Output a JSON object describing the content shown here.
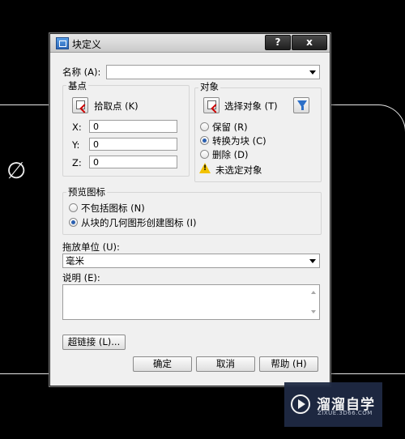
{
  "dialog": {
    "title": "块定义",
    "help_button": "?",
    "close_button": "x"
  },
  "name": {
    "label": "名称 (A):",
    "value": ""
  },
  "base_point": {
    "group_title": "基点",
    "pick_label": "拾取点 (K)",
    "x_label": "X:",
    "x_value": "0",
    "y_label": "Y:",
    "y_value": "0",
    "z_label": "Z:",
    "z_value": "0"
  },
  "objects": {
    "group_title": "对象",
    "select_label": "选择对象 (T)",
    "retain_label": "保留 (R)",
    "convert_label": "转换为块 (C)",
    "delete_label": "删除 (D)",
    "warning_text": "未选定对象",
    "selected_option": "convert"
  },
  "preview": {
    "group_title": "预览图标",
    "no_icon_label": "不包括图标 (N)",
    "create_icon_label": "从块的几何图形创建图标 (I)",
    "selected_option": "create"
  },
  "units": {
    "label": "拖放单位 (U):",
    "value": "毫米"
  },
  "description": {
    "label": "说明 (E):",
    "value": ""
  },
  "buttons": {
    "hyperlink": "超链接 (L)...",
    "ok": "确定",
    "cancel": "取消",
    "help": "帮助 (H)"
  },
  "background": {
    "symbol": "∅"
  },
  "watermark": {
    "name": "溜溜自学",
    "url": "ZIXUE.3D66.COM"
  },
  "colors": {
    "accent": "#2a5fb0",
    "warning": "#f2c200",
    "watermark_bg": "#1f2a44"
  }
}
